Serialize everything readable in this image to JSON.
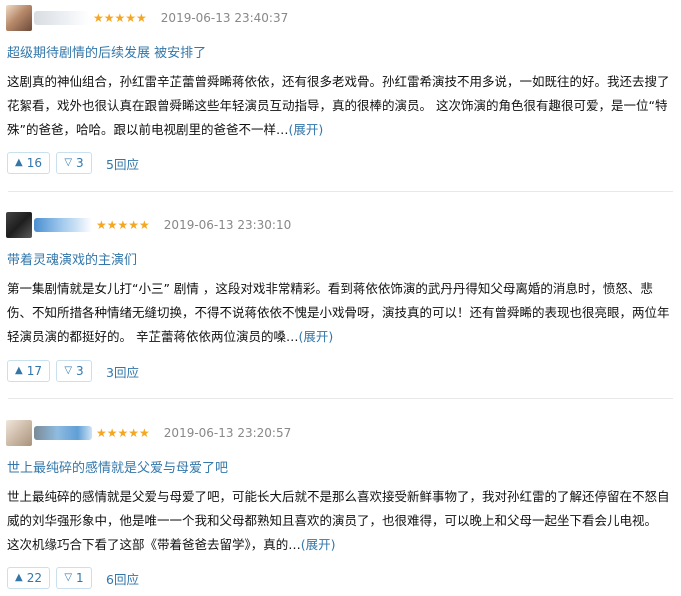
{
  "reviews": [
    {
      "stars": "★★★★★",
      "rating": 5,
      "time": "2019-06-13 23:40:37",
      "title": "超级期待剧情的后续发展 被安排了",
      "body": "这剧真的神仙组合，孙红雷辛芷蕾曾舜睎蒋依依，还有很多老戏骨。孙红雷希演技不用多说，一如既往的好。我还去搜了花絮看，戏外也很认真在跟曾舜睎这些年轻演员互动指导，真的很棒的演员。 这次饰演的角色很有趣很可爱，是一位“特殊”的爸爸，哈哈。跟以前电视剧里的爸爸不一样…",
      "more": "(展开)",
      "up_icon": "▲",
      "up_count": "16",
      "down_icon": "▽",
      "down_count": "3",
      "replies": "5回应"
    },
    {
      "stars": "★★★★★",
      "rating": 5,
      "time": "2019-06-13 23:30:10",
      "title": "带着灵魂演戏的主演们",
      "body": "第一集剧情就是女儿打“小三” 剧情 ，这段对戏非常精彩。看到蒋依依饰演的武丹丹得知父母离婚的消息时，愤怒、悲伤、不知所措各种情绪无缝切换，不得不说蒋依依不愧是小戏骨呀，演技真的可以！还有曾舜睎的表现也很亮眼，两位年轻演员演的都挺好的。 辛芷蕾蒋依依两位演员的嗓…",
      "more": "(展开)",
      "up_icon": "▲",
      "up_count": "17",
      "down_icon": "▽",
      "down_count": "3",
      "replies": "3回应"
    },
    {
      "stars": "★★★★★",
      "rating": 5,
      "time": "2019-06-13 23:20:57",
      "title": "世上最纯碎的感情就是父爱与母爱了吧",
      "body": "世上最纯碎的感情就是父爱与母爱了吧，可能长大后就不是那么喜欢接受新鲜事物了，我对孙红雷的了解还停留在不怒自威的刘华强形象中，他是唯一一个我和父母都熟知且喜欢的演员了，也很难得，可以晚上和父母一起坐下看会儿电视。 这次机缘巧合下看了这部《带着爸爸去留学》，真的…",
      "more": "(展开)",
      "up_icon": "▲",
      "up_count": "22",
      "down_icon": "▽",
      "down_count": "1",
      "replies": "6回应"
    }
  ],
  "colors": {
    "link": "#3377aa",
    "star": "#f5a623",
    "meta": "#888888",
    "text": "#111111",
    "button_border": "#c9e0ee",
    "divider": "#e8e8e8"
  },
  "icons": {
    "upvote": "up-triangle-icon",
    "downvote": "down-triangle-icon",
    "rating": "star-icon"
  }
}
